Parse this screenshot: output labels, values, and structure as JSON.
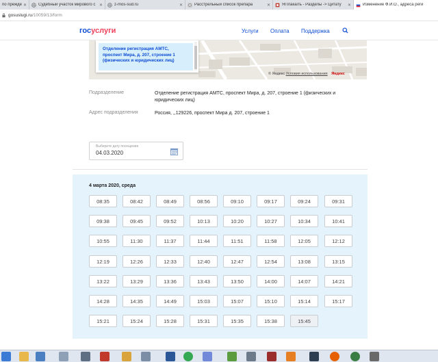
{
  "browser": {
    "tabs": [
      {
        "label": "по прежде",
        "active": false
      },
      {
        "label": "Судебный участок мирового с",
        "active": false
      },
      {
        "label": "z-mos-sud.ru",
        "active": false
      },
      {
        "label": "Расстрельный список препара",
        "active": false
      },
      {
        "label": "ЯПлакалъ - Разделы -> Цитату",
        "active": false
      },
      {
        "label": "Изменение Ф.И.О., адреса реги",
        "active": true
      }
    ],
    "url_host": "gosuslugi.ru",
    "url_path": "/10059/13/form"
  },
  "header": {
    "logo_part1": "гос",
    "logo_part2": "услуги",
    "nav": [
      "Услуги",
      "Оплата",
      "Поддержка"
    ]
  },
  "map": {
    "popup_text": "Отделение регистрация АМТС, проспект Мира, д. 207, строение 1 (физических и юридических лиц)",
    "copyright": "© Яндекс",
    "terms_link": "Условия использования",
    "brand": "Яндекс"
  },
  "details": {
    "division_label": "Подразделение",
    "division_value": "Отделение регистрация АМТС, проспект Мира, д. 207, строение 1 (физических и юридических лиц)",
    "address_label": "Адрес подразделения",
    "address_value": "Россия, ,,129226, проспект Мира д. 207, строение 1"
  },
  "date_picker": {
    "label": "Выберите дату посещения",
    "value": "04.03.2020"
  },
  "slots": {
    "heading": "4 марта 2020, среда",
    "times": [
      "08:35",
      "08:42",
      "08:49",
      "08:56",
      "09:10",
      "09:17",
      "09:24",
      "09:31",
      "09:38",
      "09:45",
      "09:52",
      "10:13",
      "10:20",
      "10:27",
      "10:34",
      "10:41",
      "10:55",
      "11:30",
      "11:37",
      "11:44",
      "11:51",
      "11:58",
      "12:05",
      "12:12",
      "12:19",
      "12:26",
      "12:33",
      "12:40",
      "12:47",
      "12:54",
      "13:08",
      "13:15",
      "13:22",
      "13:29",
      "13:36",
      "13:43",
      "13:50",
      "14:00",
      "14:07",
      "14:21",
      "14:28",
      "14:35",
      "14:49",
      "15:03",
      "15:07",
      "15:10",
      "15:14",
      "15:17",
      "15:21",
      "15:24",
      "15:28",
      "15:31",
      "15:35",
      "15:38",
      "15:45"
    ],
    "selected": "15:45"
  }
}
